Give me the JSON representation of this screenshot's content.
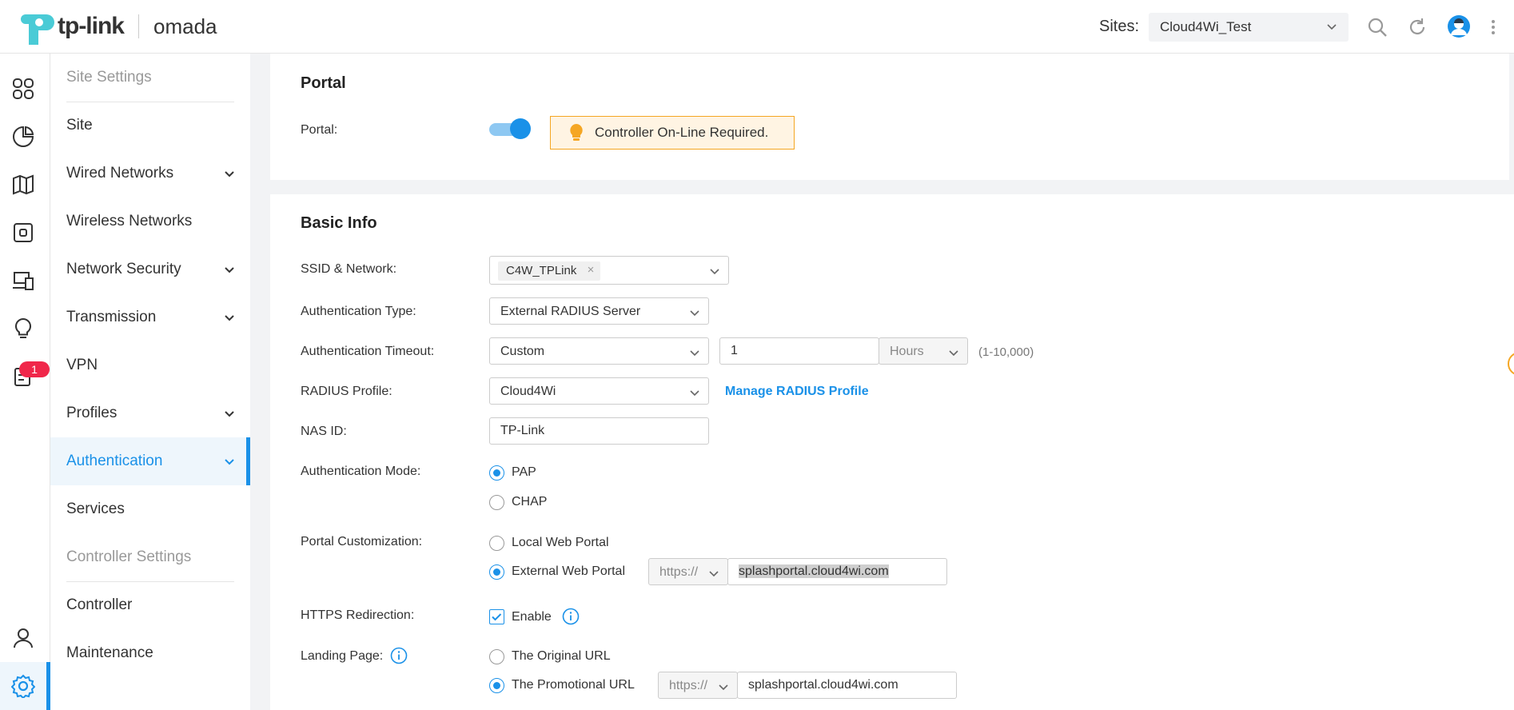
{
  "header": {
    "brand": "tp-link",
    "product": "omada",
    "sites_label": "Sites:",
    "site_selected": "Cloud4Wi_Test"
  },
  "rail": {
    "badge_count": "1"
  },
  "sidebar": {
    "items": [
      {
        "label": "Site Settings",
        "type": "section"
      },
      {
        "label": "Site"
      },
      {
        "label": "Wired Networks",
        "expandable": true
      },
      {
        "label": "Wireless Networks"
      },
      {
        "label": "Network Security",
        "expandable": true
      },
      {
        "label": "Transmission",
        "expandable": true
      },
      {
        "label": "VPN"
      },
      {
        "label": "Profiles",
        "expandable": true
      },
      {
        "label": "Authentication",
        "expandable": true,
        "active": true
      },
      {
        "label": "Services"
      },
      {
        "label": "Controller Settings",
        "type": "section"
      },
      {
        "label": "Controller"
      },
      {
        "label": "Maintenance"
      }
    ]
  },
  "portal": {
    "title": "Portal",
    "portal_label": "Portal:",
    "portal_enabled": true,
    "notice": "Controller On-Line Required."
  },
  "basic_info": {
    "title": "Basic Info",
    "ssid_label": "SSID & Network:",
    "ssid_tag": "C4W_TPLink",
    "auth_type_label": "Authentication Type:",
    "auth_type_value": "External RADIUS Server",
    "auth_timeout_label": "Authentication Timeout:",
    "auth_timeout_mode": "Custom",
    "auth_timeout_value": "1",
    "auth_timeout_unit": "Hours",
    "auth_timeout_range": "(1-10,000)",
    "radius_profile_label": "RADIUS Profile:",
    "radius_profile_value": "Cloud4Wi",
    "manage_radius_link": "Manage RADIUS Profile",
    "nas_id_label": "NAS ID:",
    "nas_id_value": "TP-Link",
    "auth_mode_label": "Authentication Mode:",
    "auth_mode_options": [
      "PAP",
      "CHAP"
    ],
    "auth_mode_selected": "PAP",
    "portal_custom_label": "Portal Customization:",
    "portal_custom_options": [
      "Local Web Portal",
      "External Web Portal"
    ],
    "portal_custom_selected": "External Web Portal",
    "external_protocol": "https://",
    "external_url": "splashportal.cloud4wi.com",
    "https_redirect_label": "HTTPS Redirection:",
    "https_redirect_option": "Enable",
    "https_redirect_checked": true,
    "landing_page_label": "Landing Page:",
    "landing_options": [
      "The Original URL",
      "The Promotional URL"
    ],
    "landing_selected": "The Promotional URL",
    "promo_protocol": "https://",
    "promo_url": "splashportal.cloud4wi.com"
  },
  "colors": {
    "accent": "#1a91e8",
    "notice_bg": "#fff4e3",
    "notice_border": "#f5a623",
    "badge": "#f0274a"
  }
}
